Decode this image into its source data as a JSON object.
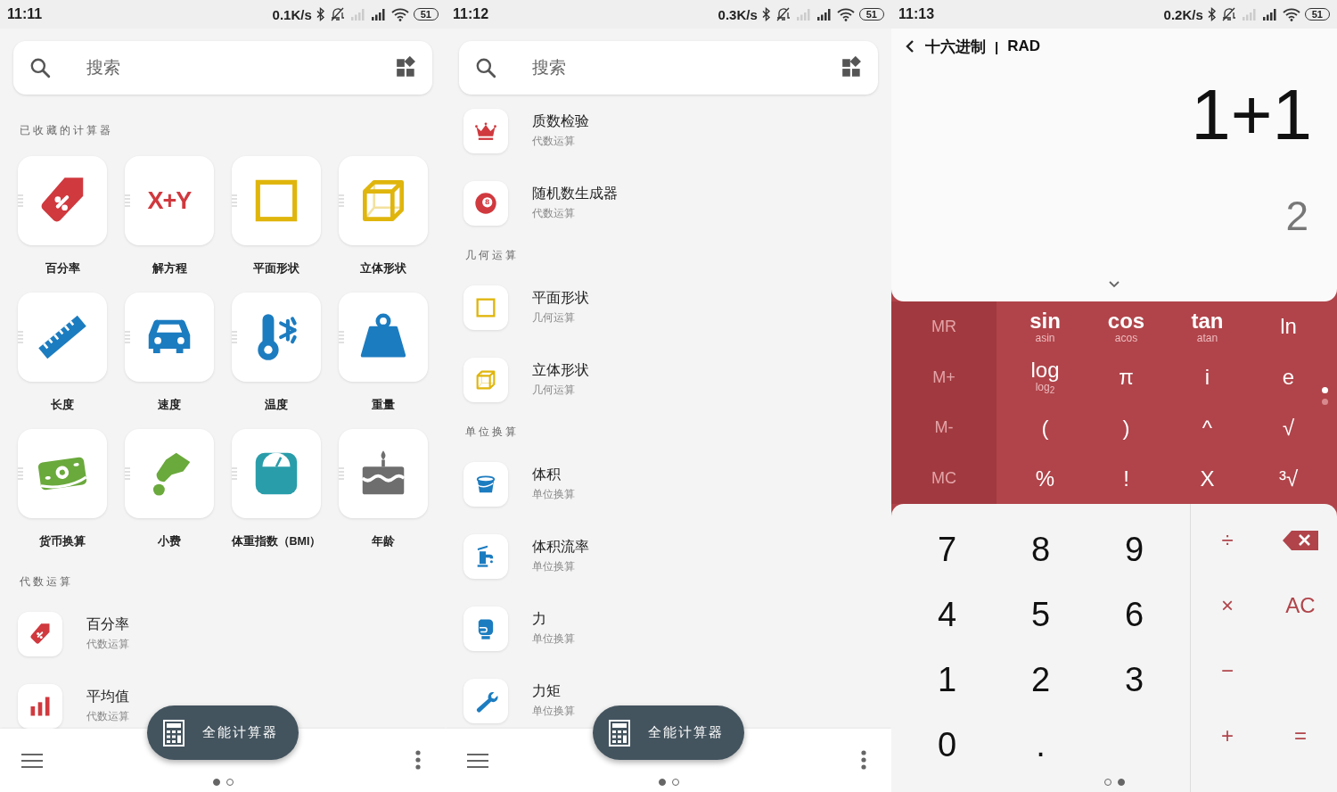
{
  "screens": [
    {
      "kind": "catalog",
      "status_bar": {
        "time": "11:11",
        "speed": "0.1K/s",
        "battery": "51"
      },
      "search": {
        "placeholder": "搜索"
      },
      "sections": [
        {
          "title": "已收藏的计算器",
          "kind": "grid",
          "items": [
            {
              "label": "百分率",
              "kind": "tag",
              "color": "#d0393e"
            },
            {
              "label": "解方程",
              "kind": "glyph",
              "glyph": "X+Y",
              "color": "#d0393e"
            },
            {
              "label": "平面形状",
              "kind": "square",
              "color": "#e0b50c"
            },
            {
              "label": "立体形状",
              "kind": "cube",
              "color": "#e0b50c"
            },
            {
              "label": "长度",
              "kind": "ruler",
              "color": "#1c7cc0"
            },
            {
              "label": "速度",
              "kind": "car",
              "color": "#1c7cc0"
            },
            {
              "label": "温度",
              "kind": "thermometer",
              "color": "#1c7cc0"
            },
            {
              "label": "重量",
              "kind": "weight",
              "color": "#1c7cc0"
            },
            {
              "label": "货币换算",
              "kind": "money",
              "color": "#6aa93c"
            },
            {
              "label": "小费",
              "kind": "hand",
              "color": "#6aa93c"
            },
            {
              "label": "体重指数（BMI）",
              "kind": "scale",
              "color": "#2a9daa"
            },
            {
              "label": "年龄",
              "kind": "cake",
              "color": "#6e6e6e"
            }
          ]
        },
        {
          "title": "代数运算",
          "kind": "list",
          "items": [
            {
              "label": "百分率",
              "subtitle": "代数运算",
              "kind": "tag",
              "color": "#d0393e"
            },
            {
              "label": "平均值",
              "subtitle": "代数运算",
              "kind": "bars",
              "color": "#d0393e"
            }
          ]
        }
      ],
      "fab": {
        "label": "全能计算器"
      },
      "page_dots": [
        {
          "selected": true
        },
        {
          "selected": false
        }
      ]
    },
    {
      "kind": "catalog",
      "status_bar": {
        "time": "11:12",
        "speed": "0.3K/s",
        "battery": "51"
      },
      "search": {
        "placeholder": "搜索"
      },
      "sections": [
        {
          "kind": "list",
          "items": [
            {
              "label": "质数检验",
              "subtitle": "代数运算",
              "kind": "crown",
              "color": "#d0393e"
            },
            {
              "label": "随机数生成器",
              "subtitle": "代数运算",
              "kind": "ball",
              "glyph": "8",
              "color": "#d0393e"
            }
          ]
        },
        {
          "title": "几何运算",
          "kind": "list",
          "items": [
            {
              "label": "平面形状",
              "subtitle": "几何运算",
              "kind": "square",
              "color": "#e0b50c"
            },
            {
              "label": "立体形状",
              "subtitle": "几何运算",
              "kind": "cube",
              "color": "#e0b50c"
            }
          ]
        },
        {
          "title": "单位换算",
          "kind": "list",
          "items": [
            {
              "label": "体积",
              "subtitle": "单位换算",
              "kind": "bucket",
              "color": "#1c7cc0"
            },
            {
              "label": "体积流率",
              "subtitle": "单位换算",
              "kind": "faucet",
              "color": "#1c7cc0"
            },
            {
              "label": "力",
              "subtitle": "单位换算",
              "kind": "glove",
              "color": "#1c7cc0"
            },
            {
              "label": "力矩",
              "subtitle": "单位换算",
              "kind": "wrench",
              "color": "#1c7cc0"
            }
          ]
        }
      ],
      "fab": {
        "label": "全能计算器"
      },
      "page_dots": [
        {
          "selected": true
        },
        {
          "selected": false
        }
      ]
    },
    {
      "kind": "calculator",
      "status_bar": {
        "time": "11:13",
        "speed": "0.2K/s",
        "battery": "51"
      },
      "header": {
        "mode": "十六进制",
        "separator": "|",
        "angle": "RAD"
      },
      "expression": "1+1",
      "result": "2",
      "memory_keys": [
        "MR",
        "M+",
        "M-",
        "MC"
      ],
      "function_keys": [
        {
          "kind": "bold",
          "label": "sin",
          "sub": "asin"
        },
        {
          "kind": "bold",
          "label": "cos",
          "sub": "acos"
        },
        {
          "kind": "bold",
          "label": "tan",
          "sub": "atan"
        },
        {
          "kind": "plain",
          "label": "ln"
        },
        {
          "kind": "plain",
          "label": "log",
          "sub": "log$_{2}$"
        },
        {
          "kind": "plain",
          "label": "π"
        },
        {
          "kind": "plain",
          "label": "i"
        },
        {
          "kind": "plain",
          "label": "e"
        },
        {
          "kind": "plain",
          "label": "("
        },
        {
          "kind": "plain",
          "label": ")"
        },
        {
          "kind": "plain",
          "label": "^"
        },
        {
          "kind": "plain",
          "label": "√"
        },
        {
          "kind": "plain",
          "label": "%"
        },
        {
          "kind": "plain",
          "label": "!"
        },
        {
          "kind": "plain",
          "label": "X"
        },
        {
          "kind": "plain",
          "label": "³√"
        }
      ],
      "side_dots": [
        {
          "selected": true
        },
        {
          "selected": false
        }
      ],
      "digit_keys": [
        "7",
        "8",
        "9",
        "4",
        "5",
        "6",
        "1",
        "2",
        "3",
        "0",
        "."
      ],
      "operator_keys": [
        {
          "kind": "text",
          "label": "÷"
        },
        {
          "kind": "backspace"
        },
        {
          "kind": "text",
          "label": "×"
        },
        {
          "kind": "text",
          "label": "AC"
        },
        {
          "kind": "text",
          "label": "−"
        },
        {
          "kind": "blank"
        },
        {
          "kind": "text",
          "label": "+"
        },
        {
          "kind": "text",
          "label": "="
        }
      ],
      "page_dots": [
        {
          "selected": false
        },
        {
          "selected": true
        }
      ]
    }
  ]
}
